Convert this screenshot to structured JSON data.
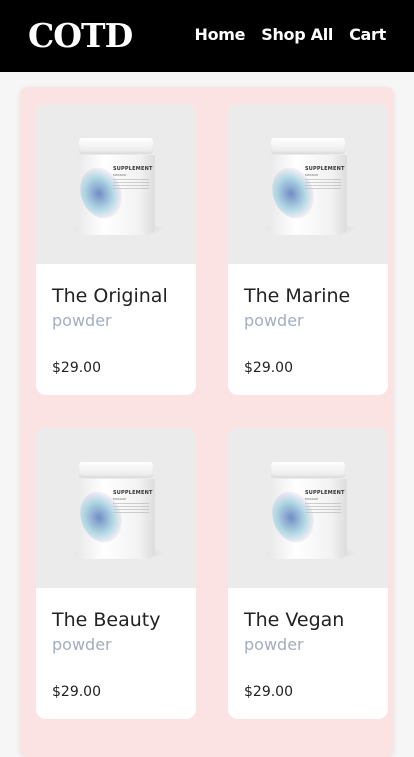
{
  "header": {
    "logo": "COTD",
    "nav": [
      {
        "label": "Home"
      },
      {
        "label": "Shop All"
      },
      {
        "label": "Cart"
      }
    ]
  },
  "jar_label": {
    "title": "SUPPLEMENT",
    "subtitle": "MOCKUP"
  },
  "products": [
    {
      "name": "The Original",
      "subtitle": "powder",
      "price": "$29.00",
      "image_icon": "supplement-jar-icon"
    },
    {
      "name": "The Marine",
      "subtitle": "powder",
      "price": "$29.00",
      "image_icon": "supplement-jar-icon"
    },
    {
      "name": "The Beauty",
      "subtitle": "powder",
      "price": "$29.00",
      "image_icon": "supplement-jar-icon"
    },
    {
      "name": "The Vegan",
      "subtitle": "powder",
      "price": "$29.00",
      "image_icon": "supplement-jar-icon"
    }
  ],
  "colors": {
    "header_bg": "#000000",
    "panel_bg": "#fbe3e3",
    "subtitle": "#a3aebf"
  }
}
